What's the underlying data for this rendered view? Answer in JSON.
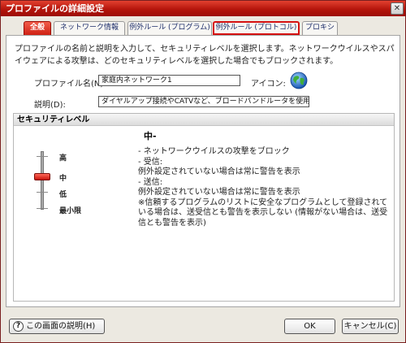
{
  "window": {
    "title": "プロファイルの詳細設定",
    "close_label": "✕"
  },
  "tabs": [
    {
      "label": "全般",
      "active": true
    },
    {
      "label": "ネットワーク情報"
    },
    {
      "label": "例外ルール (プログラム)"
    },
    {
      "label": "例外ルール (プロトコル)",
      "highlighted": true
    },
    {
      "label": "プロキシ"
    }
  ],
  "general": {
    "description": "プロファイルの名前と説明を入力して、セキュリティレベルを選択します。ネットワークウイルスやスパイウェアによる攻撃は、どのセキュリティレベルを選択した場合でもブロックされます。",
    "profile_name_label": "プロファイル名(N):",
    "profile_name_value": "家庭内ネットワーク1",
    "icon_label": "アイコン:",
    "icon": "globe-icon",
    "explanation_label": "説明(D):",
    "explanation_value": "ダイヤルアップ接続やCATVなど、ブロードバンドルータを使用しな"
  },
  "security": {
    "header": "セキュリティレベル",
    "levels": [
      "高",
      "中",
      "低",
      "最小限"
    ],
    "selected_index": 1,
    "selected_title": "中-",
    "details": "- ネットワークウイルスの攻撃をブロック\n- 受信:\n  例外設定されていない場合は常に警告を表示\n- 送信:\n  例外設定されていない場合は常に警告を表示\n※信頼するプログラムのリストに安全なプログラムとして登録されている場合は、送受信とも警告を表示しない (情報がない場合は、送受信とも警告を表示)"
  },
  "buttons": {
    "help_label": "この画面の説明(H)",
    "ok_label": "OK",
    "cancel_label": "キャンセル(C)"
  },
  "colors": {
    "title_bar": "#b5150c",
    "active_tab": "#cc1d10",
    "highlight_border": "#d51010"
  }
}
